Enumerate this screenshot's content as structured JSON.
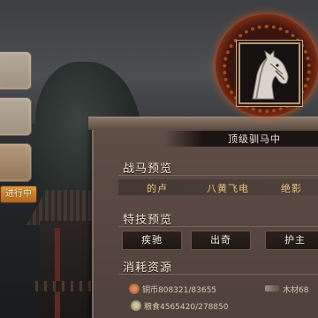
{
  "tabs": {
    "progress_badge": "进行中"
  },
  "horse": {
    "name": "顶级驯马中"
  },
  "sections": {
    "horse_preview": {
      "title": "战马预览",
      "items": [
        "的卢",
        "八黄飞电",
        "绝影"
      ]
    },
    "trait_preview": {
      "title": "特技预览",
      "items": [
        "疾驰",
        "出奇",
        "护主"
      ]
    },
    "resources": {
      "title": "消耗资源",
      "copper": "铜币808321/83655",
      "wood": "木材68",
      "grain": "粮食4565420/278850"
    }
  },
  "colors": {
    "accent_gold": "#e8c37a",
    "panel_brown": "#5e4e46",
    "badge_orange": "#d9a040",
    "portrait_glow": "#e7782a"
  }
}
